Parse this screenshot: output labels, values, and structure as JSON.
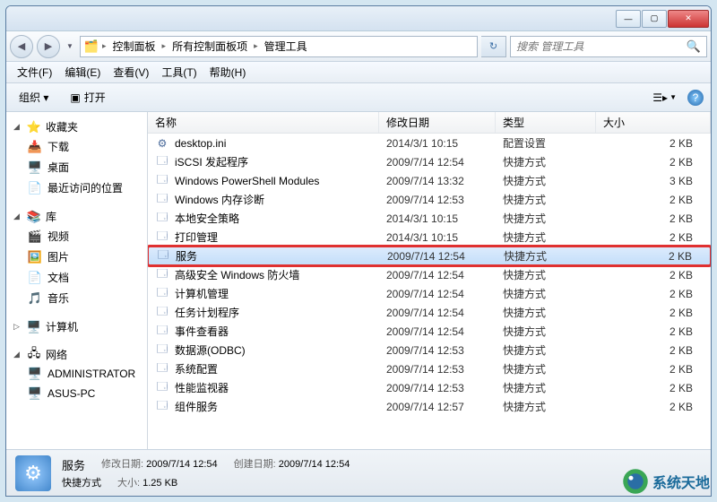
{
  "window": {
    "min": "—",
    "max": "▢",
    "close": "✕"
  },
  "breadcrumb": {
    "segments": [
      "控制面板",
      "所有控制面板项",
      "管理工具"
    ]
  },
  "search": {
    "placeholder": "搜索 管理工具"
  },
  "menubar": {
    "file": "文件(F)",
    "edit": "编辑(E)",
    "view": "查看(V)",
    "tools": "工具(T)",
    "help": "帮助(H)"
  },
  "toolbar": {
    "organize": "组织 ▾",
    "open": "打开"
  },
  "sidebar": {
    "favorites": {
      "label": "收藏夹",
      "items": [
        "下载",
        "桌面",
        "最近访问的位置"
      ]
    },
    "libraries": {
      "label": "库",
      "items": [
        "视频",
        "图片",
        "文档",
        "音乐"
      ]
    },
    "computer": {
      "label": "计算机"
    },
    "network": {
      "label": "网络",
      "items": [
        "ADMINISTRATOR",
        "ASUS-PC"
      ]
    }
  },
  "columns": {
    "name": "名称",
    "date": "修改日期",
    "type": "类型",
    "size": "大小"
  },
  "files": [
    {
      "name": "desktop.ini",
      "date": "2014/3/1 10:15",
      "type": "配置设置",
      "size": "2 KB",
      "icon": "⚙"
    },
    {
      "name": "iSCSI 发起程序",
      "date": "2009/7/14 12:54",
      "type": "快捷方式",
      "size": "2 KB",
      "icon": "🗔"
    },
    {
      "name": "Windows PowerShell Modules",
      "date": "2009/7/14 13:32",
      "type": "快捷方式",
      "size": "3 KB",
      "icon": "🗔"
    },
    {
      "name": "Windows 内存诊断",
      "date": "2009/7/14 12:53",
      "type": "快捷方式",
      "size": "2 KB",
      "icon": "🗔"
    },
    {
      "name": "本地安全策略",
      "date": "2014/3/1 10:15",
      "type": "快捷方式",
      "size": "2 KB",
      "icon": "🗔"
    },
    {
      "name": "打印管理",
      "date": "2014/3/1 10:15",
      "type": "快捷方式",
      "size": "2 KB",
      "icon": "🗔"
    },
    {
      "name": "服务",
      "date": "2009/7/14 12:54",
      "type": "快捷方式",
      "size": "2 KB",
      "icon": "🗔",
      "selected": true,
      "highlighted": true
    },
    {
      "name": "高级安全 Windows 防火墙",
      "date": "2009/7/14 12:54",
      "type": "快捷方式",
      "size": "2 KB",
      "icon": "🗔"
    },
    {
      "name": "计算机管理",
      "date": "2009/7/14 12:54",
      "type": "快捷方式",
      "size": "2 KB",
      "icon": "🗔"
    },
    {
      "name": "任务计划程序",
      "date": "2009/7/14 12:54",
      "type": "快捷方式",
      "size": "2 KB",
      "icon": "🗔"
    },
    {
      "name": "事件查看器",
      "date": "2009/7/14 12:54",
      "type": "快捷方式",
      "size": "2 KB",
      "icon": "🗔"
    },
    {
      "name": "数据源(ODBC)",
      "date": "2009/7/14 12:53",
      "type": "快捷方式",
      "size": "2 KB",
      "icon": "🗔"
    },
    {
      "name": "系统配置",
      "date": "2009/7/14 12:53",
      "type": "快捷方式",
      "size": "2 KB",
      "icon": "🗔"
    },
    {
      "name": "性能监视器",
      "date": "2009/7/14 12:53",
      "type": "快捷方式",
      "size": "2 KB",
      "icon": "🗔"
    },
    {
      "name": "组件服务",
      "date": "2009/7/14 12:57",
      "type": "快捷方式",
      "size": "2 KB",
      "icon": "🗔"
    }
  ],
  "status": {
    "title": "服务",
    "type_label": "快捷方式",
    "modified_label": "修改日期:",
    "modified_value": "2009/7/14 12:54",
    "created_label": "创建日期:",
    "created_value": "2009/7/14 12:54",
    "size_label": "大小:",
    "size_value": "1.25 KB"
  },
  "watermark": "系统天地"
}
